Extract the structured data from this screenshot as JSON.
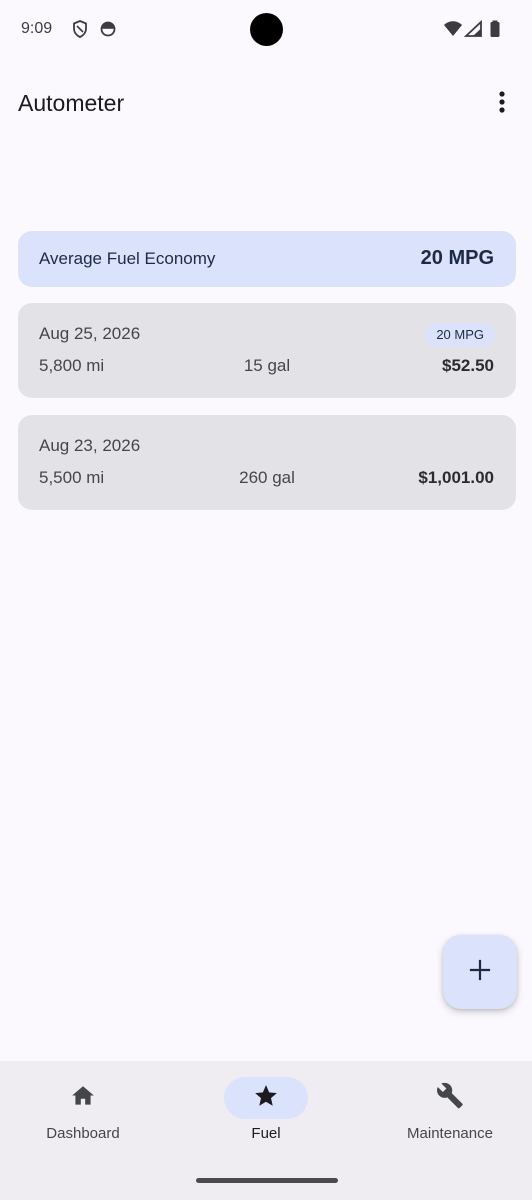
{
  "status_bar": {
    "time": "9:09",
    "left_icons": [
      "shield-icon",
      "circle-status-icon"
    ],
    "right_icons": [
      "wifi-icon",
      "cell-signal-icon",
      "battery-icon"
    ]
  },
  "app_bar": {
    "title": "Autometer",
    "overflow_icon": "more-vert-icon"
  },
  "summary": {
    "label": "Average Fuel Economy",
    "value": "20 MPG"
  },
  "entries": [
    {
      "date": "Aug 25, 2026",
      "badge": "20 MPG",
      "odometer": "5,800 mi",
      "volume": "15 gal",
      "cost": "$52.50"
    },
    {
      "date": "Aug 23, 2026",
      "badge": "",
      "odometer": "5,500 mi",
      "volume": "260 gal",
      "cost": "$1,001.00"
    }
  ],
  "fab": {
    "icon": "add-icon"
  },
  "bottom_nav": {
    "items": [
      {
        "label": "Dashboard",
        "icon": "home-icon",
        "active": false
      },
      {
        "label": "Fuel",
        "icon": "star-icon",
        "active": true
      },
      {
        "label": "Maintenance",
        "icon": "wrench-icon",
        "active": false
      }
    ]
  },
  "colors": {
    "background": "#FBF9FD",
    "summary_card": "#DAE2FC",
    "entry_card": "#E3E2E6",
    "nav_background": "#EFEDF1",
    "active_indicator": "#DAE2FC"
  }
}
